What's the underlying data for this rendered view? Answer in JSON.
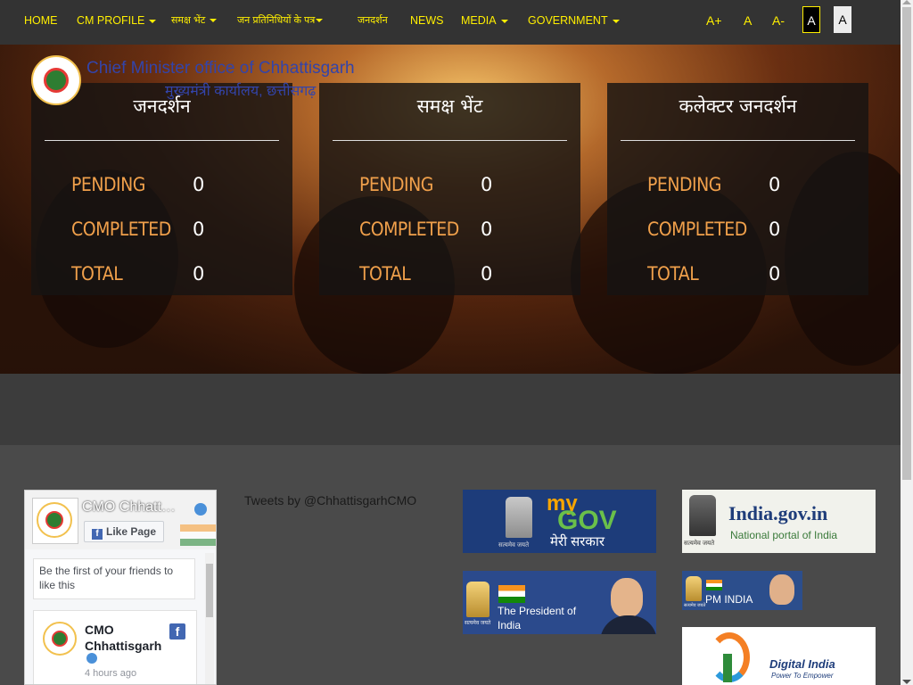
{
  "nav": {
    "items": [
      {
        "label": "HOME",
        "dropdown": false
      },
      {
        "label": "CM PROFILE",
        "dropdown": true
      },
      {
        "label": "समक्ष भेंट",
        "dropdown": true
      },
      {
        "label": "जन प्रतिनिधियों के पत्र",
        "dropdown": true
      },
      {
        "label": "जनदर्शन",
        "dropdown": false
      },
      {
        "label": "NEWS",
        "dropdown": false
      },
      {
        "label": "MEDIA",
        "dropdown": true
      },
      {
        "label": "GOVERNMENT",
        "dropdown": true
      }
    ],
    "font_sizes": [
      "A+",
      "A",
      "A-"
    ],
    "contrast": [
      "A",
      "A"
    ],
    "accent_color": "#ffef00"
  },
  "header": {
    "title_en": "Chief Minister office of Chhattisgarh",
    "title_hi": "मुख्यमंत्री कार्यालय, छत्तीसगढ़"
  },
  "panels": [
    {
      "title": "जनदर्शन",
      "stats": [
        {
          "label": "PENDING",
          "value": "0"
        },
        {
          "label": "COMPLETED",
          "value": "0"
        },
        {
          "label": "TOTAL",
          "value": "0"
        }
      ]
    },
    {
      "title": "समक्ष भेंट",
      "stats": [
        {
          "label": "PENDING",
          "value": "0"
        },
        {
          "label": "COMPLETED",
          "value": "0"
        },
        {
          "label": "TOTAL",
          "value": "0"
        }
      ]
    },
    {
      "title": "कलेक्टर जनदर्शन",
      "stats": [
        {
          "label": "PENDING",
          "value": "0"
        },
        {
          "label": "COMPLETED",
          "value": "0"
        },
        {
          "label": "TOTAL",
          "value": "0"
        }
      ]
    }
  ],
  "facebook": {
    "page_name": "CMO Chhatt…",
    "like_button": "Like Page",
    "friends_text": "Be the first of your friends to like this",
    "post_author": "CMO Chhattisgarh",
    "post_time": "4 hours ago"
  },
  "tweets": {
    "label": "Tweets by @ChhattisgarhCMO"
  },
  "banners": {
    "mygov": {
      "line1": "my",
      "line2": "GOV",
      "line3": "मेरी सरकार",
      "emblem_text": "सत्यमेव जयते"
    },
    "india_gov": {
      "title": "India.gov.in",
      "subtitle": "National portal of India",
      "emblem_text": "सत्यमेव जयते"
    },
    "president": {
      "line1": "The President of",
      "line2": "India",
      "emblem_text": "सत्यमेव जयते"
    },
    "pm_india": {
      "label": "PM INDIA",
      "emblem_text": "सत्यमेव जयते"
    },
    "digital_india": {
      "title": "Digital India",
      "subtitle": "Power To Empower"
    }
  }
}
